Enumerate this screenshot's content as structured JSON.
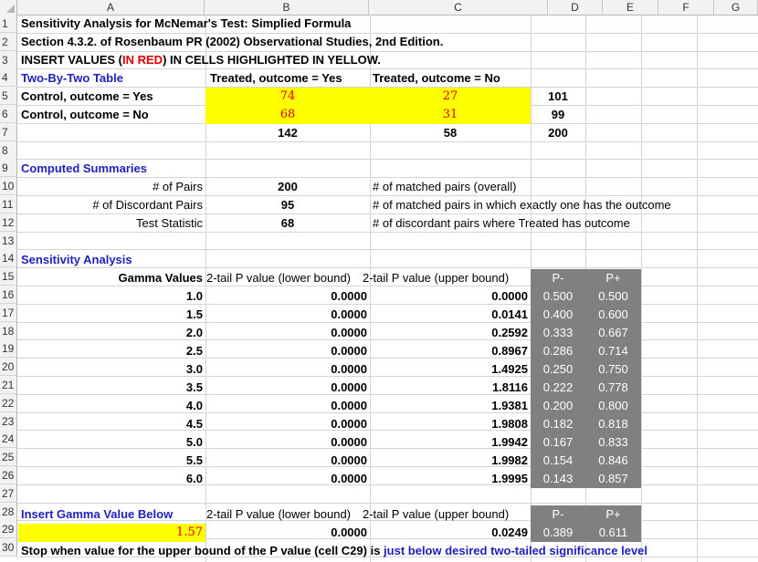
{
  "columns": [
    "A",
    "B",
    "C",
    "D",
    "E",
    "F",
    "G"
  ],
  "rows": [
    "1",
    "2",
    "3",
    "4",
    "5",
    "6",
    "7",
    "8",
    "9",
    "10",
    "11",
    "12",
    "13",
    "14",
    "15",
    "16",
    "17",
    "18",
    "19",
    "20",
    "21",
    "22",
    "23",
    "24",
    "25",
    "26",
    "27",
    "28",
    "29",
    "30"
  ],
  "header": {
    "title": "Sensitivity Analysis for McNemar's Test: Simplied Formula",
    "section": "Section 4.3.2. of Rosenbaum PR (2002) Observational Studies, 2nd Edition.",
    "insert_prefix": "INSERT VALUES (",
    "insert_red": "IN RED",
    "insert_suffix": ") IN CELLS HIGHLIGHTED IN YELLOW."
  },
  "table2x2": {
    "label": "Two-By-Two Table",
    "col1": "Treated, outcome = Yes",
    "col2": "Treated, outcome = No",
    "row1_label": "Control, outcome = Yes",
    "row2_label": "Control, outcome = No",
    "r1c1": "74",
    "r1c2": "27",
    "r1_total": "101",
    "r2c1": "68",
    "r2c2": "31",
    "r2_total": "99",
    "total_c1": "142",
    "total_c2": "58",
    "grand_total": "200"
  },
  "summaries": {
    "label": "Computed Summaries",
    "pairs_label": "# of Pairs",
    "pairs_value": "200",
    "pairs_note": "# of matched pairs (overall)",
    "disc_label": "# of Discordant Pairs",
    "disc_value": "95",
    "disc_note": "# of matched pairs in which exactly one has the outcome",
    "stat_label": "Test Statistic",
    "stat_value": "68",
    "stat_note": "# of discordant pairs where Treated has outcome"
  },
  "sensitivity": {
    "label": "Sensitivity Analysis",
    "h_gamma": "Gamma Values",
    "h_lower": "2-tail P value (lower bound)",
    "h_upper": "2-tail P value (upper bound)",
    "h_pminus": "P-",
    "h_pplus": "P+",
    "rows": [
      {
        "gamma": "1.0",
        "lower": "0.0000",
        "upper": "0.0000",
        "pm": "0.500",
        "pp": "0.500"
      },
      {
        "gamma": "1.5",
        "lower": "0.0000",
        "upper": "0.0141",
        "pm": "0.400",
        "pp": "0.600"
      },
      {
        "gamma": "2.0",
        "lower": "0.0000",
        "upper": "0.2592",
        "pm": "0.333",
        "pp": "0.667"
      },
      {
        "gamma": "2.5",
        "lower": "0.0000",
        "upper": "0.8967",
        "pm": "0.286",
        "pp": "0.714"
      },
      {
        "gamma": "3.0",
        "lower": "0.0000",
        "upper": "1.4925",
        "pm": "0.250",
        "pp": "0.750"
      },
      {
        "gamma": "3.5",
        "lower": "0.0000",
        "upper": "1.8116",
        "pm": "0.222",
        "pp": "0.778"
      },
      {
        "gamma": "4.0",
        "lower": "0.0000",
        "upper": "1.9381",
        "pm": "0.200",
        "pp": "0.800"
      },
      {
        "gamma": "4.5",
        "lower": "0.0000",
        "upper": "1.9808",
        "pm": "0.182",
        "pp": "0.818"
      },
      {
        "gamma": "5.0",
        "lower": "0.0000",
        "upper": "1.9942",
        "pm": "0.167",
        "pp": "0.833"
      },
      {
        "gamma": "5.5",
        "lower": "0.0000",
        "upper": "1.9982",
        "pm": "0.154",
        "pp": "0.846"
      },
      {
        "gamma": "6.0",
        "lower": "0.0000",
        "upper": "1.9995",
        "pm": "0.143",
        "pp": "0.857"
      }
    ]
  },
  "insert_gamma": {
    "label": "Insert Gamma Value Below",
    "h_lower": "2-tail P value (lower bound)",
    "h_upper": "2-tail P value (upper bound)",
    "h_pminus": "P-",
    "h_pplus": "P+",
    "gamma": "1.57",
    "lower": "0.0000",
    "upper": "0.0249",
    "pm": "0.389",
    "pp": "0.611"
  },
  "footer": {
    "prefix": "Stop when value for the upper bound of the P value (cell C29) is ",
    "blue": "just below desired two-tailed significance level"
  },
  "colors": {
    "yellow": "#ffff00",
    "gray": "#808080",
    "blue": "#1f1fbf",
    "red": "#e00000"
  }
}
